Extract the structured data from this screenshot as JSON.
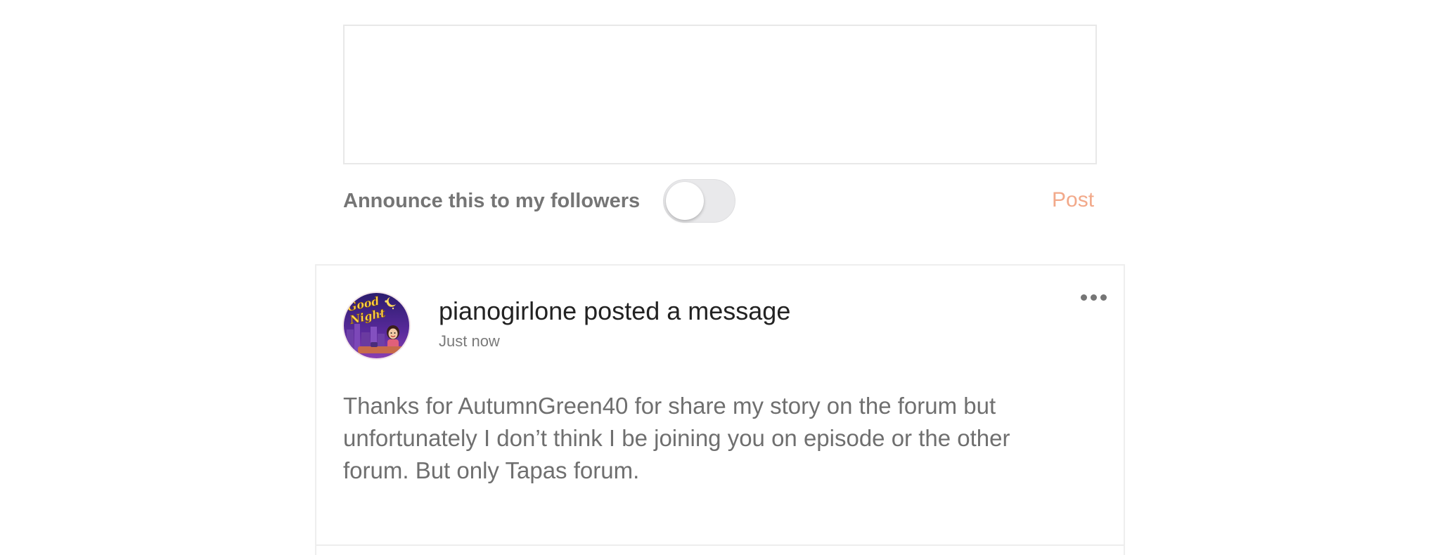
{
  "composer": {
    "text": "",
    "announce_label": "Announce this to my followers",
    "announce_enabled": false,
    "post_label": "Post"
  },
  "post": {
    "author": "pianogirlone",
    "title": "pianogirlone posted a message",
    "timestamp": "Just now",
    "body": "Thanks for AutumnGreen40 for share my story on the forum but unfortunately I don’t think I be joining you on episode or the other forum. But only Tapas forum.",
    "avatar_icon": "good-night-avatar-image",
    "more_icon": "more-horizontal-icon"
  },
  "colors": {
    "accent": "#f2a98a",
    "label": "#757575",
    "body_text": "#6f6f6f",
    "title_text": "#222222",
    "border": "#e8e8e8"
  }
}
